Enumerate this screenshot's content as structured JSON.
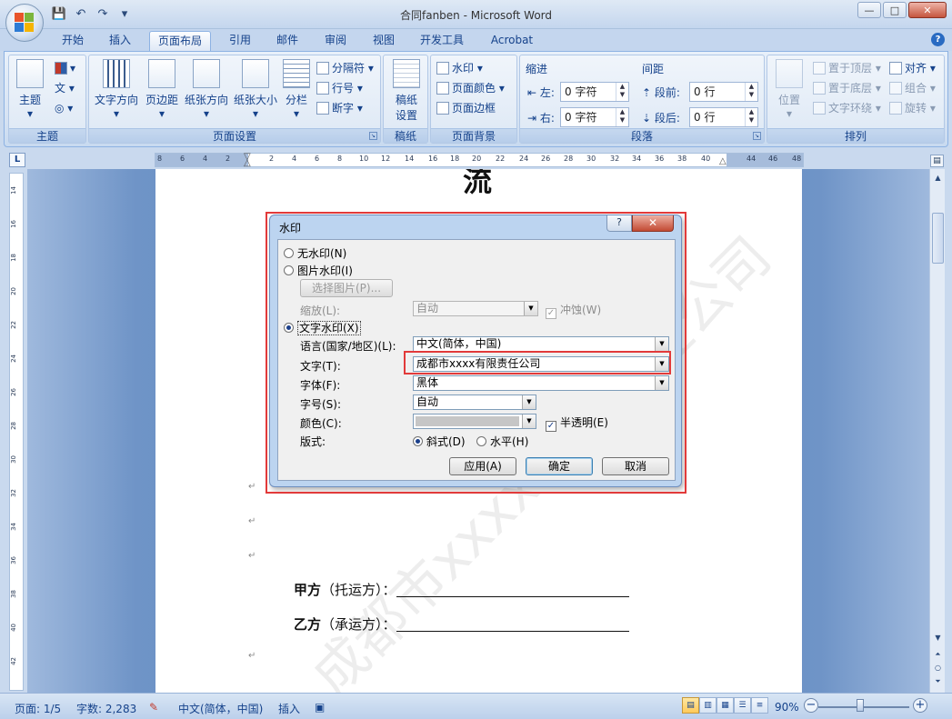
{
  "window": {
    "title": "合同fanben - Microsoft Word",
    "controls": {
      "minimize": "—",
      "maximize": "□",
      "close": "✕"
    }
  },
  "qat": {
    "save": "💾",
    "undo": "↶",
    "redo": "↷",
    "more": "▾"
  },
  "tabs": [
    {
      "label": "开始"
    },
    {
      "label": "插入"
    },
    {
      "label": "页面布局",
      "active": true
    },
    {
      "label": "引用"
    },
    {
      "label": "邮件"
    },
    {
      "label": "审阅"
    },
    {
      "label": "视图"
    },
    {
      "label": "开发工具"
    },
    {
      "label": "Acrobat"
    }
  ],
  "help": "?",
  "ribbon": {
    "theme": {
      "label": "主题",
      "button": "主题",
      "sub1": "文",
      "sub2": "◎"
    },
    "page_setup": {
      "label": "页面设置",
      "text_direction": "文字方向",
      "margins": "页边距",
      "orientation": "纸张方向",
      "size": "纸张大小",
      "columns": "分栏",
      "breaks": "分隔符",
      "line_numbers": "行号",
      "hyphenation": "断字"
    },
    "draft": {
      "label": "稿纸",
      "button": "稿纸\n设置",
      "btn_line1": "稿纸",
      "btn_line2": "设置"
    },
    "page_background": {
      "label": "页面背景",
      "watermark": "水印",
      "page_color": "页面颜色",
      "page_borders": "页面边框"
    },
    "paragraph": {
      "label": "段落",
      "indent": "缩进",
      "spacing": "间距",
      "left_label": "左:",
      "left_value": "0 字符",
      "right_label": "右:",
      "right_value": "0 字符",
      "before_label": "段前:",
      "before_value": "0 行",
      "after_label": "段后:",
      "after_value": "0 行"
    },
    "arrange": {
      "label": "排列",
      "position": "位置",
      "bring_front": "置于顶层",
      "send_back": "置于底层",
      "text_wrap": "文字环绕",
      "align": "对齐",
      "group": "组合",
      "rotate": "旋转"
    }
  },
  "ruler": {
    "corner": "L",
    "h_ticks": [
      "8",
      "6",
      "4",
      "2",
      "2",
      "4",
      "6",
      "8",
      "10",
      "12",
      "14",
      "16",
      "18",
      "20",
      "22",
      "24",
      "26",
      "28",
      "30",
      "32",
      "34",
      "36",
      "38",
      "40",
      "",
      "44",
      "46",
      "48"
    ],
    "v_ticks": [
      "14",
      "16",
      "18",
      "20",
      "22",
      "24",
      "26",
      "28",
      "30",
      "32",
      "34",
      "36",
      "38",
      "40",
      "42"
    ]
  },
  "document": {
    "title_fragment": "流",
    "watermark_text": "成都市xxxx有限责任公司",
    "para_mark": "↵",
    "party_a_label": "甲方",
    "party_a_role": "（托运方）：",
    "party_b_label": "乙方",
    "party_b_role": "（承运方）："
  },
  "dialog": {
    "title": "水印",
    "help": "?",
    "close": "✕",
    "no_watermark": "无水印(N)",
    "picture_watermark": "图片水印(I)",
    "select_picture": "选择图片(P)...",
    "scale_label": "缩放(L):",
    "scale_value": "自动",
    "washout": "冲蚀(W)",
    "text_watermark": "文字水印(X)",
    "language_label": "语言(国家/地区)(L):",
    "language_value": "中文(简体，中国)",
    "text_label": "文字(T):",
    "text_value": "成都市xxxx有限责任公司",
    "font_label": "字体(F):",
    "font_value": "黑体",
    "size_label": "字号(S):",
    "size_value": "自动",
    "color_label": "颜色(C):",
    "semitransparent": "半透明(E)",
    "layout_label": "版式:",
    "diagonal": "斜式(D)",
    "horizontal": "水平(H)",
    "apply": "应用(A)",
    "ok": "确定",
    "cancel": "取消",
    "check_mark": "✓"
  },
  "statusbar": {
    "page": "页面: 1/5",
    "words": "字数: 2,283",
    "language": "中文(简体，中国)",
    "insert_mode": "插入",
    "zoom": "90%",
    "zoom_minus": "−",
    "zoom_plus": "+"
  },
  "colors": {
    "accent": "#15428b",
    "highlight": "#e23a3a",
    "ribbon_bg": "#dde8f5"
  }
}
